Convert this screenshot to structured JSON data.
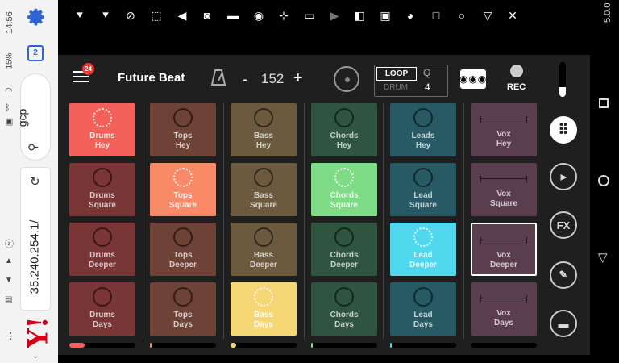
{
  "system": {
    "time": "14:56",
    "battery": "15%",
    "search_text": "gcp",
    "url": "35.240.254.1/",
    "yahoo": "Y!",
    "version": "5.0.0"
  },
  "toolbar_icons": [
    "cursor-down-icon",
    "cursor-icon",
    "pencil-icon",
    "select-icon",
    "back-icon",
    "record-icon",
    "eraser-icon",
    "video-icon",
    "crosshair-icon",
    "clipboard-icon",
    "play-icon",
    "square-sq-icon",
    "crop-icon",
    "clock-icon",
    "stop-square-icon",
    "circle-icon",
    "triangle-icon",
    "close-x-icon"
  ],
  "app": {
    "badge": "24",
    "title": "Future Beat",
    "minus": "-",
    "bpm": "152",
    "plus": "+",
    "loop": "LOOP",
    "drum": "DRUM",
    "q_label": "Q",
    "q_value": "4",
    "tape_label": "◉◉◉",
    "rec": "REC",
    "fx": "FX"
  },
  "columns": [
    {
      "name": "Drums",
      "color": "#7a3636",
      "lit": "#f4615b",
      "progress": 0.23,
      "prog_color": "#f4615b"
    },
    {
      "name": "Tops",
      "color": "#6e4236",
      "lit": "#f98a68",
      "progress": 0.02,
      "prog_color": "#f98a68"
    },
    {
      "name": "Bass",
      "color": "#6b5a3e",
      "lit": "#f5d776",
      "progress": 0.08,
      "prog_color": "#f5d776"
    },
    {
      "name": "Chords",
      "color": "#2f5540",
      "lit": "#7fdc86",
      "progress": 0.01,
      "prog_color": "#7fdc86"
    },
    {
      "name": "Leads",
      "color": "#275a64",
      "lit": "#4fd8ee",
      "progress": 0.01,
      "prog_color": "#4fd8ee"
    },
    {
      "name": "Vox",
      "color": "#5a3e4e",
      "lit": "#9a7a8e",
      "progress": 0,
      "prog_color": "#9a7a8e"
    }
  ],
  "pads": [
    [
      {
        "l1": "Drums",
        "l2": "Hey",
        "lit": true
      },
      {
        "l1": "Tops",
        "l2": "Hey"
      },
      {
        "l1": "Bass",
        "l2": "Hey"
      },
      {
        "l1": "Chords",
        "l2": "Hey"
      },
      {
        "l1": "Leads",
        "l2": "Hey"
      },
      {
        "l1": "Vox",
        "l2": "Hey"
      }
    ],
    [
      {
        "l1": "Drums",
        "l2": "Square"
      },
      {
        "l1": "Tops",
        "l2": "Square",
        "lit": true
      },
      {
        "l1": "Bass",
        "l2": "Square"
      },
      {
        "l1": "Chords",
        "l2": "Square",
        "lit": true
      },
      {
        "l1": "Lead",
        "l2": "Square"
      },
      {
        "l1": "Vox",
        "l2": "Square"
      }
    ],
    [
      {
        "l1": "Drums",
        "l2": "Deeper"
      },
      {
        "l1": "Tops",
        "l2": "Deeper"
      },
      {
        "l1": "Bass",
        "l2": "Deeper"
      },
      {
        "l1": "Chords",
        "l2": "Deeper"
      },
      {
        "l1": "Lead",
        "l2": "Deeper",
        "lit": true
      },
      {
        "l1": "Vox",
        "l2": "Deeper",
        "selected": true
      }
    ],
    [
      {
        "l1": "Drums",
        "l2": "Days"
      },
      {
        "l1": "Tops",
        "l2": "Days"
      },
      {
        "l1": "Bass",
        "l2": "Days",
        "lit": true
      },
      {
        "l1": "Chords",
        "l2": "Days"
      },
      {
        "l1": "Lead",
        "l2": "Days"
      },
      {
        "l1": "Vox",
        "l2": "Days"
      }
    ]
  ]
}
